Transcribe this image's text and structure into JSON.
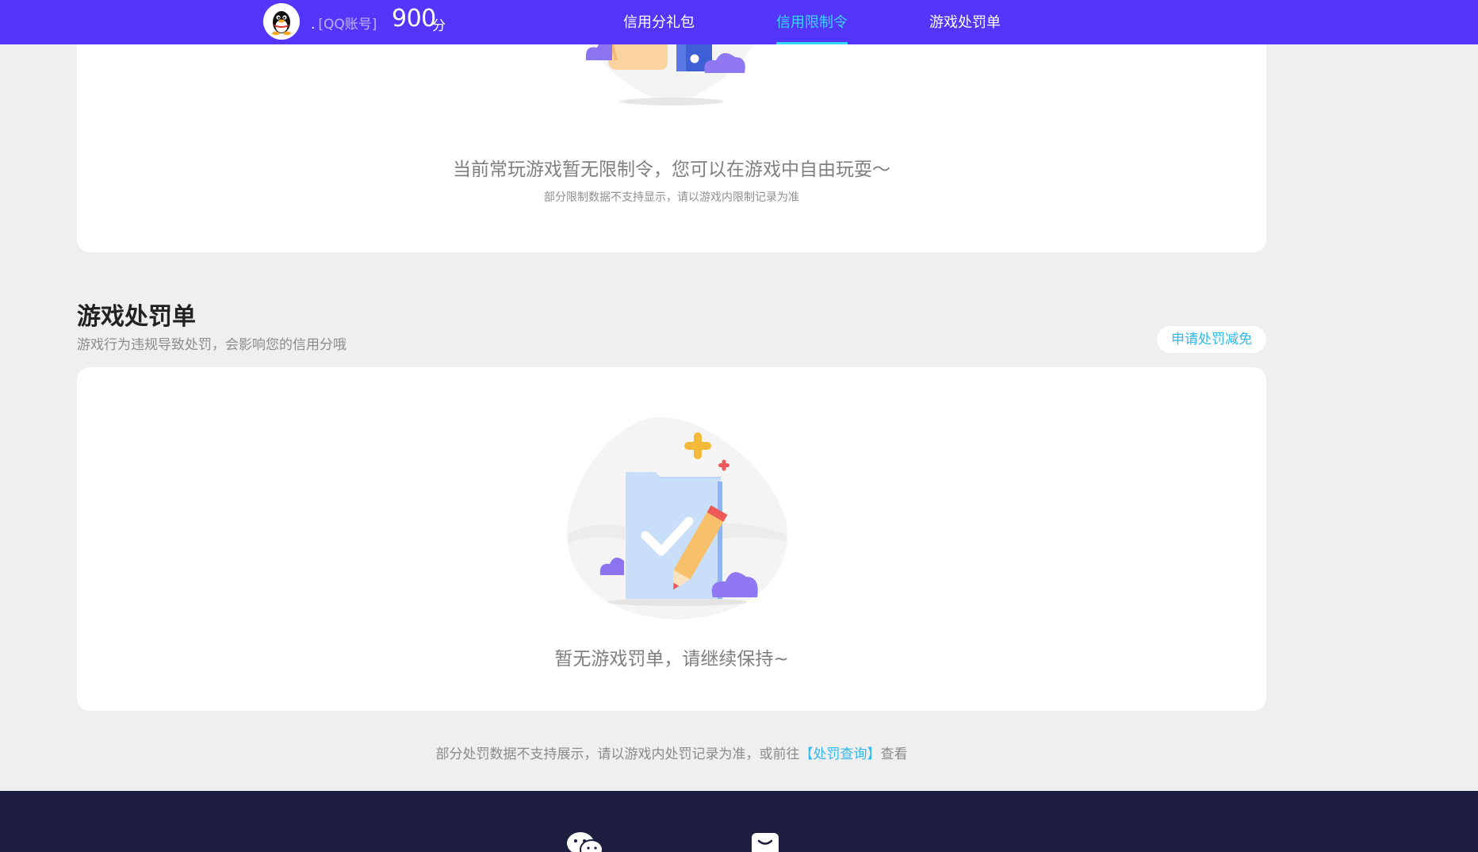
{
  "header": {
    "account_dot": ".",
    "account_label": "[QQ账号]",
    "score": "900",
    "score_unit": "分",
    "nav": [
      {
        "label": "信用分礼包",
        "active": false
      },
      {
        "label": "信用限制令",
        "active": true
      },
      {
        "label": "游戏处罚单",
        "active": false
      }
    ]
  },
  "restriction_card": {
    "message": "当前常玩游戏暂无限制令，您可以在游戏中自由玩耍～",
    "note": "部分限制数据不支持显示，请以游戏内限制记录为准"
  },
  "penalty_section": {
    "title": "游戏处罚单",
    "description": "游戏行为违规导致处罚，会影响您的信用分哦",
    "apply_button": "申请处罚减免",
    "empty_message": "暂无游戏罚单，请继续保持~"
  },
  "footnote": {
    "text_before": "部分处罚数据不支持展示，请以游戏内处罚记录为准，或前往",
    "link": "【处罚查询】",
    "text_after": "查看"
  },
  "colors": {
    "header_bg": "#5436fb",
    "nav_active": "#38d5ff",
    "link": "#31b9ee",
    "footer_bg": "#1c1d3f"
  },
  "icons": [
    "qq-penguin-icon",
    "wechat-icon",
    "chat-bubble-icon"
  ]
}
